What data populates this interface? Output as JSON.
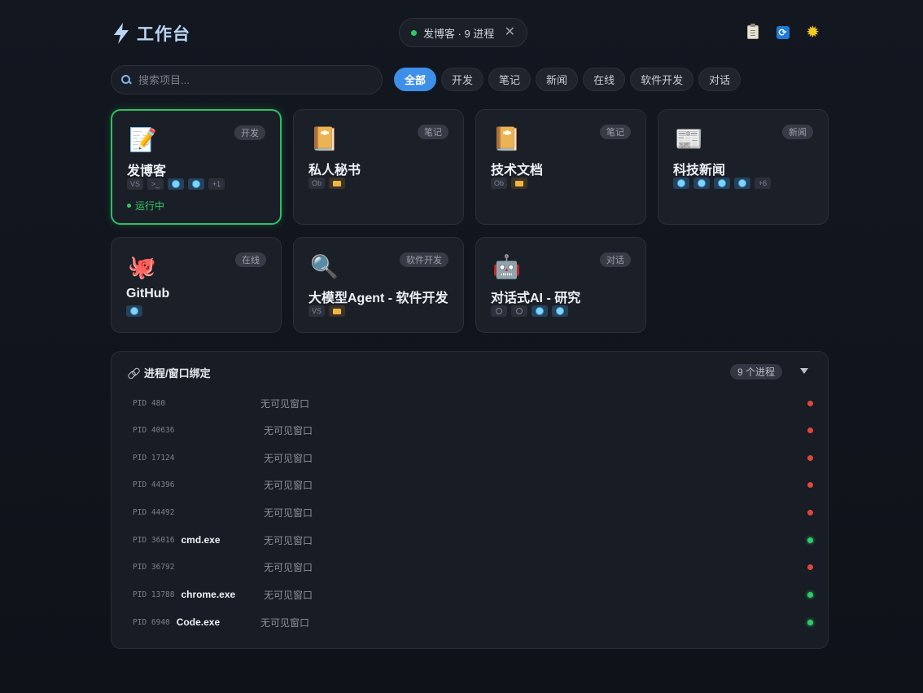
{
  "header": {
    "title": "工作台",
    "status": "发博客 · 9 进程",
    "close": "✕"
  },
  "colors": {
    "accent": "#3d8fe8",
    "running": "#2fca67",
    "stopped": "#e0453c"
  },
  "search": {
    "placeholder": "搜索项目..."
  },
  "filters": [
    "全部",
    "开发",
    "笔记",
    "新闻",
    "在线",
    "软件开发",
    "对话"
  ],
  "cards": [
    {
      "title": "发博客",
      "tag": "开发",
      "icon": "memo-icon",
      "emoji": "📝",
      "badges": [
        "VS",
        ">_",
        "globe",
        "globe",
        "+1"
      ],
      "status": "运行中"
    },
    {
      "title": "私人秘书",
      "tag": "笔记",
      "icon": "notebook-icon",
      "emoji": "📔",
      "badges": [
        "Ob",
        "folder"
      ]
    },
    {
      "title": "技术文档",
      "tag": "笔记",
      "icon": "notebook-icon",
      "emoji": "📔",
      "badges": [
        "Ob",
        "folder"
      ]
    },
    {
      "title": "科技新闻",
      "tag": "新闻",
      "icon": "newspaper-icon",
      "emoji": "📰",
      "badges": [
        "globe",
        "globe",
        "globe",
        "globe",
        "+6"
      ]
    },
    {
      "title": "GitHub",
      "tag": "在线",
      "icon": "octopus-icon",
      "emoji": "🐙",
      "badges": [
        "globe"
      ]
    },
    {
      "title": "大模型Agent - 软件开发",
      "tag": "软件开发",
      "icon": "magnifier-icon",
      "emoji": "🔍",
      "badges": [
        "VS",
        "folder"
      ]
    },
    {
      "title": "对话式AI - 研究",
      "tag": "对话",
      "icon": "robot-icon",
      "emoji": "🤖",
      "badges": [
        "blank",
        "blank",
        "globe",
        "globe"
      ]
    }
  ],
  "processes": {
    "title": "进程/窗口绑定",
    "count": "9 个进程",
    "rows": [
      {
        "pid": "PID 480",
        "name": "",
        "window": "无可见窗口",
        "state": "red"
      },
      {
        "pid": "PID 40636",
        "name": "",
        "window": "无可见窗口",
        "state": "red"
      },
      {
        "pid": "PID 17124",
        "name": "",
        "window": "无可见窗口",
        "state": "red"
      },
      {
        "pid": "PID 44396",
        "name": "",
        "window": "无可见窗口",
        "state": "red"
      },
      {
        "pid": "PID 44492",
        "name": "",
        "window": "无可见窗口",
        "state": "red"
      },
      {
        "pid": "PID 36016",
        "name": "cmd.exe",
        "window": "无可见窗口",
        "state": "green"
      },
      {
        "pid": "PID 36792",
        "name": "",
        "window": "无可见窗口",
        "state": "red"
      },
      {
        "pid": "PID 13788",
        "name": "chrome.exe",
        "window": "无可见窗口",
        "state": "green"
      },
      {
        "pid": "PID 6940",
        "name": "Code.exe",
        "window": "无可见窗口",
        "state": "green"
      }
    ]
  }
}
